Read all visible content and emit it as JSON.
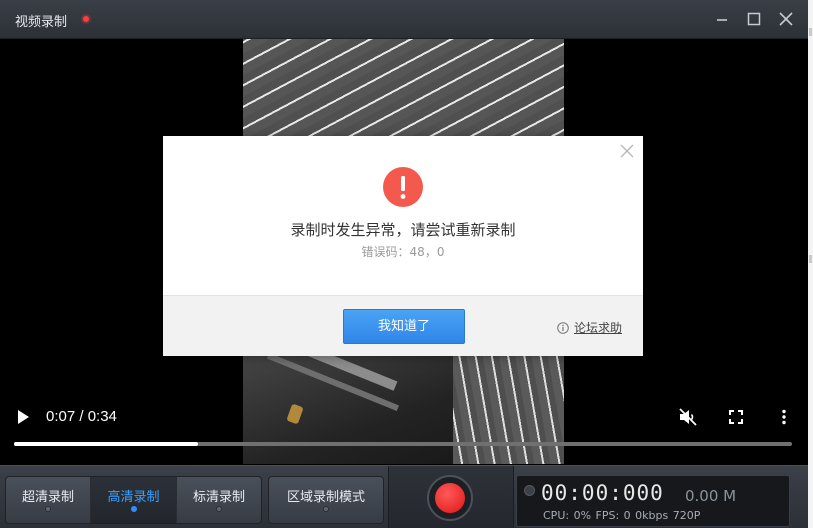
{
  "window": {
    "title": "视频录制"
  },
  "player": {
    "time": "0:07 / 0:34",
    "progress_fraction": 0.236
  },
  "dialog": {
    "message": "录制时发生异常，请尝试重新录制",
    "error_code": "错误码：48，0",
    "ok_label": "我知道了",
    "help_label": "论坛求助",
    "icon_color": "#f4594e",
    "button_color": "#2f86e8"
  },
  "toolbar": {
    "modes": [
      {
        "label": "超清录制",
        "active": false
      },
      {
        "label": "高清录制",
        "active": true
      },
      {
        "label": "标清录制",
        "active": false
      }
    ],
    "region_label": "区域录制模式"
  },
  "stats": {
    "timer": "00:00:000",
    "size": "0.00 M",
    "perf": "CPU: 0%  FPS: 0  0kbps  720P"
  }
}
